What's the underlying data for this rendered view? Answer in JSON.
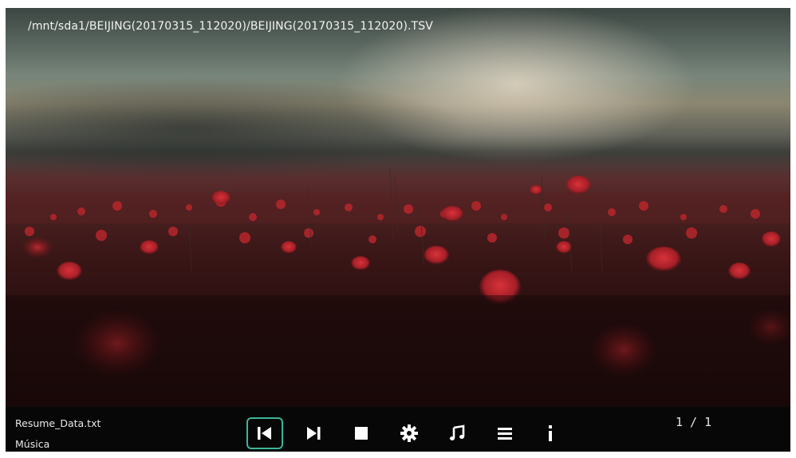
{
  "player": {
    "file_path": "/mnt/sda1/BEIJING(20170315_112020)/BEIJING(20170315_112020).TSV"
  },
  "status": {
    "resume_file": "Resume_Data.txt",
    "category": "Música",
    "page_counter": "1 / 1"
  },
  "controls": [
    {
      "name": "previous",
      "icon": "skip-previous-icon",
      "selected": true
    },
    {
      "name": "next",
      "icon": "skip-next-icon",
      "selected": false
    },
    {
      "name": "stop",
      "icon": "stop-icon",
      "selected": false
    },
    {
      "name": "settings",
      "icon": "gear-icon",
      "selected": false
    },
    {
      "name": "music",
      "icon": "music-note-icon",
      "selected": false
    },
    {
      "name": "playlist",
      "icon": "list-icon",
      "selected": false
    },
    {
      "name": "info",
      "icon": "info-icon",
      "selected": false
    }
  ],
  "colors": {
    "focus_border": "#3bb59b",
    "bar_background": "#070707",
    "text": "#f2f2f2"
  }
}
